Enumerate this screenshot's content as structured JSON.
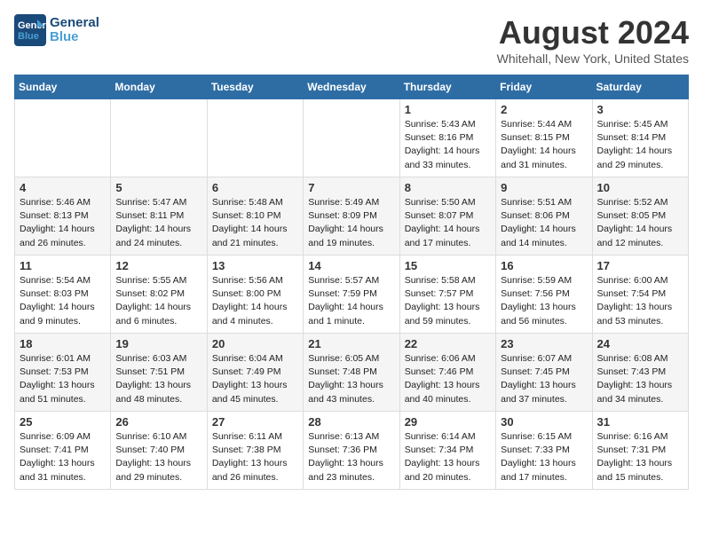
{
  "header": {
    "logo_general": "General",
    "logo_blue": "Blue",
    "title": "August 2024",
    "subtitle": "Whitehall, New York, United States"
  },
  "weekdays": [
    "Sunday",
    "Monday",
    "Tuesday",
    "Wednesday",
    "Thursday",
    "Friday",
    "Saturday"
  ],
  "weeks": [
    [
      {
        "day": "",
        "info": ""
      },
      {
        "day": "",
        "info": ""
      },
      {
        "day": "",
        "info": ""
      },
      {
        "day": "",
        "info": ""
      },
      {
        "day": "1",
        "info": "Sunrise: 5:43 AM\nSunset: 8:16 PM\nDaylight: 14 hours\nand 33 minutes."
      },
      {
        "day": "2",
        "info": "Sunrise: 5:44 AM\nSunset: 8:15 PM\nDaylight: 14 hours\nand 31 minutes."
      },
      {
        "day": "3",
        "info": "Sunrise: 5:45 AM\nSunset: 8:14 PM\nDaylight: 14 hours\nand 29 minutes."
      }
    ],
    [
      {
        "day": "4",
        "info": "Sunrise: 5:46 AM\nSunset: 8:13 PM\nDaylight: 14 hours\nand 26 minutes."
      },
      {
        "day": "5",
        "info": "Sunrise: 5:47 AM\nSunset: 8:11 PM\nDaylight: 14 hours\nand 24 minutes."
      },
      {
        "day": "6",
        "info": "Sunrise: 5:48 AM\nSunset: 8:10 PM\nDaylight: 14 hours\nand 21 minutes."
      },
      {
        "day": "7",
        "info": "Sunrise: 5:49 AM\nSunset: 8:09 PM\nDaylight: 14 hours\nand 19 minutes."
      },
      {
        "day": "8",
        "info": "Sunrise: 5:50 AM\nSunset: 8:07 PM\nDaylight: 14 hours\nand 17 minutes."
      },
      {
        "day": "9",
        "info": "Sunrise: 5:51 AM\nSunset: 8:06 PM\nDaylight: 14 hours\nand 14 minutes."
      },
      {
        "day": "10",
        "info": "Sunrise: 5:52 AM\nSunset: 8:05 PM\nDaylight: 14 hours\nand 12 minutes."
      }
    ],
    [
      {
        "day": "11",
        "info": "Sunrise: 5:54 AM\nSunset: 8:03 PM\nDaylight: 14 hours\nand 9 minutes."
      },
      {
        "day": "12",
        "info": "Sunrise: 5:55 AM\nSunset: 8:02 PM\nDaylight: 14 hours\nand 6 minutes."
      },
      {
        "day": "13",
        "info": "Sunrise: 5:56 AM\nSunset: 8:00 PM\nDaylight: 14 hours\nand 4 minutes."
      },
      {
        "day": "14",
        "info": "Sunrise: 5:57 AM\nSunset: 7:59 PM\nDaylight: 14 hours\nand 1 minute."
      },
      {
        "day": "15",
        "info": "Sunrise: 5:58 AM\nSunset: 7:57 PM\nDaylight: 13 hours\nand 59 minutes."
      },
      {
        "day": "16",
        "info": "Sunrise: 5:59 AM\nSunset: 7:56 PM\nDaylight: 13 hours\nand 56 minutes."
      },
      {
        "day": "17",
        "info": "Sunrise: 6:00 AM\nSunset: 7:54 PM\nDaylight: 13 hours\nand 53 minutes."
      }
    ],
    [
      {
        "day": "18",
        "info": "Sunrise: 6:01 AM\nSunset: 7:53 PM\nDaylight: 13 hours\nand 51 minutes."
      },
      {
        "day": "19",
        "info": "Sunrise: 6:03 AM\nSunset: 7:51 PM\nDaylight: 13 hours\nand 48 minutes."
      },
      {
        "day": "20",
        "info": "Sunrise: 6:04 AM\nSunset: 7:49 PM\nDaylight: 13 hours\nand 45 minutes."
      },
      {
        "day": "21",
        "info": "Sunrise: 6:05 AM\nSunset: 7:48 PM\nDaylight: 13 hours\nand 43 minutes."
      },
      {
        "day": "22",
        "info": "Sunrise: 6:06 AM\nSunset: 7:46 PM\nDaylight: 13 hours\nand 40 minutes."
      },
      {
        "day": "23",
        "info": "Sunrise: 6:07 AM\nSunset: 7:45 PM\nDaylight: 13 hours\nand 37 minutes."
      },
      {
        "day": "24",
        "info": "Sunrise: 6:08 AM\nSunset: 7:43 PM\nDaylight: 13 hours\nand 34 minutes."
      }
    ],
    [
      {
        "day": "25",
        "info": "Sunrise: 6:09 AM\nSunset: 7:41 PM\nDaylight: 13 hours\nand 31 minutes."
      },
      {
        "day": "26",
        "info": "Sunrise: 6:10 AM\nSunset: 7:40 PM\nDaylight: 13 hours\nand 29 minutes."
      },
      {
        "day": "27",
        "info": "Sunrise: 6:11 AM\nSunset: 7:38 PM\nDaylight: 13 hours\nand 26 minutes."
      },
      {
        "day": "28",
        "info": "Sunrise: 6:13 AM\nSunset: 7:36 PM\nDaylight: 13 hours\nand 23 minutes."
      },
      {
        "day": "29",
        "info": "Sunrise: 6:14 AM\nSunset: 7:34 PM\nDaylight: 13 hours\nand 20 minutes."
      },
      {
        "day": "30",
        "info": "Sunrise: 6:15 AM\nSunset: 7:33 PM\nDaylight: 13 hours\nand 17 minutes."
      },
      {
        "day": "31",
        "info": "Sunrise: 6:16 AM\nSunset: 7:31 PM\nDaylight: 13 hours\nand 15 minutes."
      }
    ]
  ]
}
